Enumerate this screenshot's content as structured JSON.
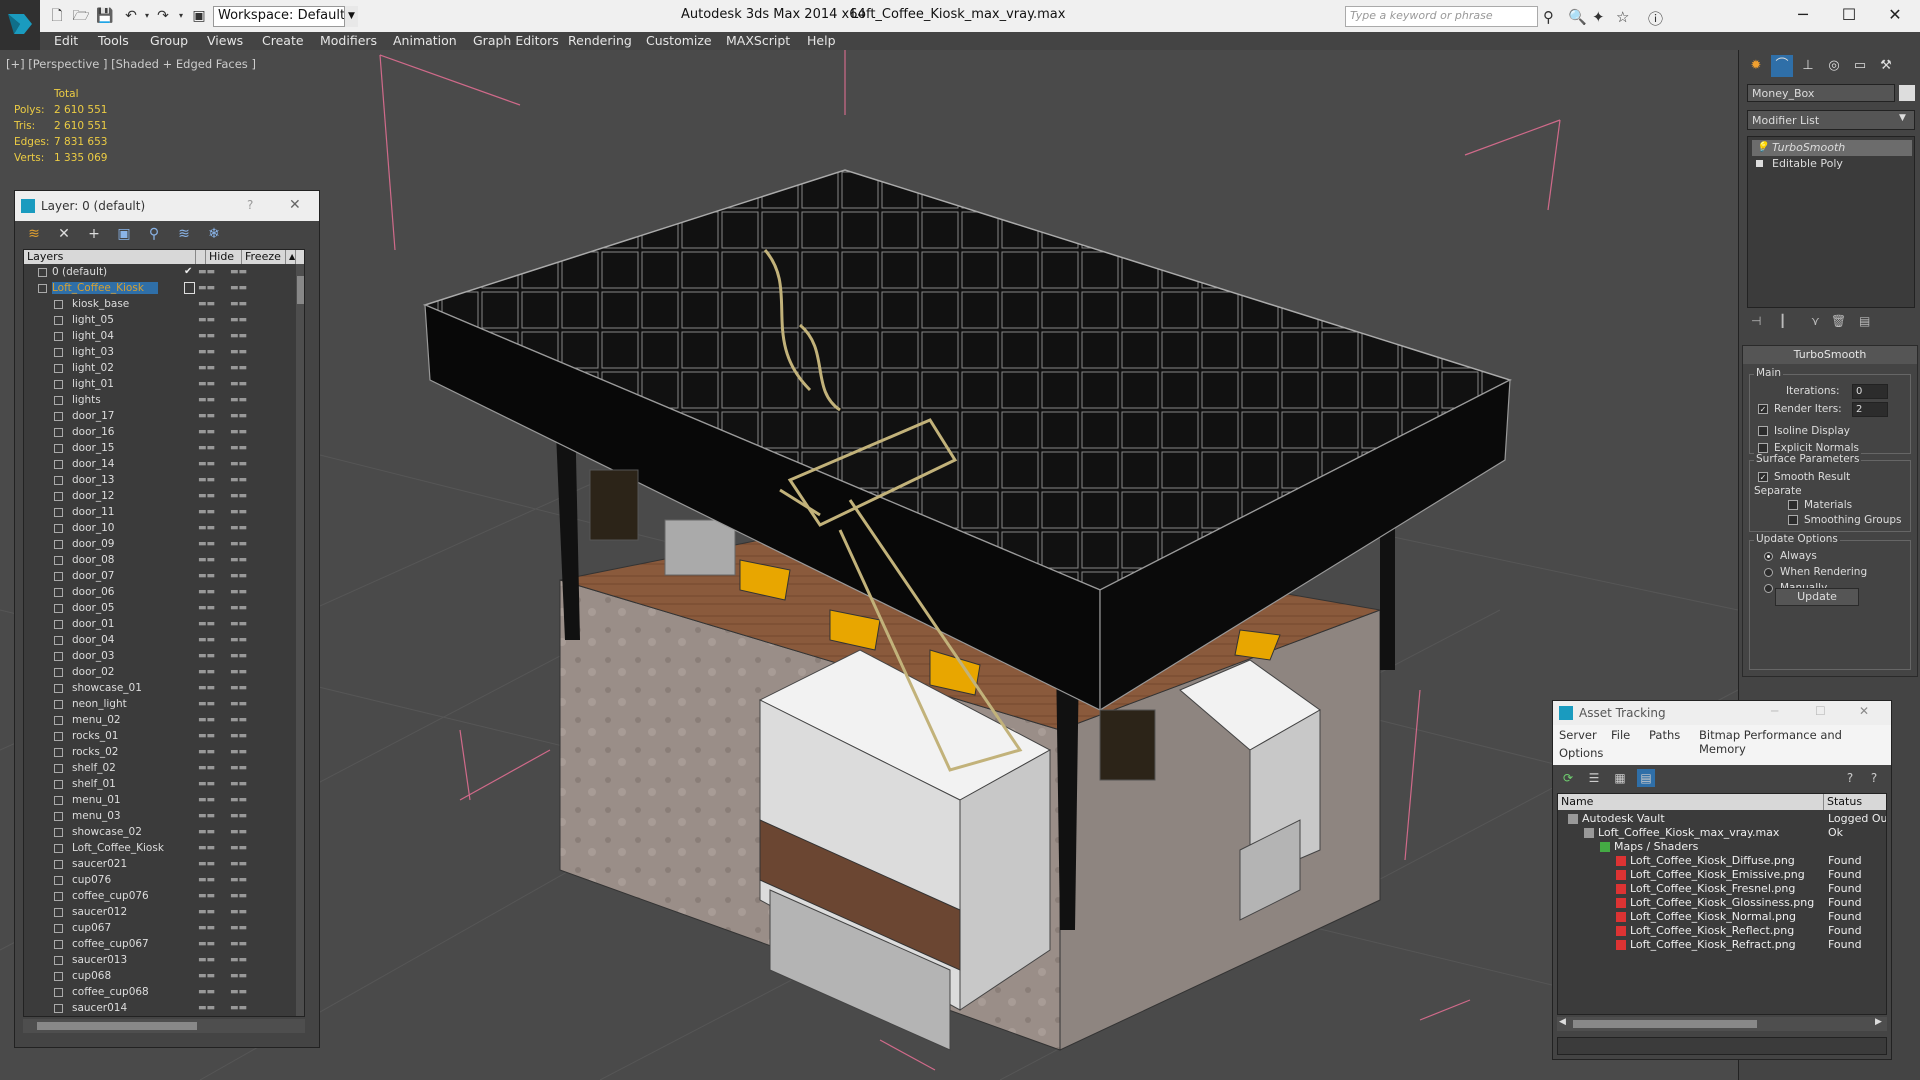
{
  "titlebar": {
    "workspace": "Workspace: Default",
    "app_title": "Autodesk 3ds Max  2014 x64",
    "file_title": "Loft_Coffee_Kiosk_max_vray.max",
    "search_placeholder": "Type a keyword or phrase"
  },
  "menu": [
    "Edit",
    "Tools",
    "Group",
    "Views",
    "Create",
    "Modifiers",
    "Animation",
    "Graph Editors",
    "Rendering",
    "Customize",
    "MAXScript",
    "Help"
  ],
  "viewport": {
    "label": "[+] [Perspective ] [Shaded + Edged Faces ]",
    "stats_header": "Total",
    "stats": [
      {
        "label": "Polys:",
        "value": "2 610 551"
      },
      {
        "label": "Tris:",
        "value": "2 610 551"
      },
      {
        "label": "Edges:",
        "value": "7 831 653"
      },
      {
        "label": "Verts:",
        "value": "1 335 069"
      }
    ]
  },
  "layer_panel": {
    "title": "Layer: 0 (default)",
    "help": "?",
    "col_layers": "Layers",
    "col_hide": "Hide",
    "col_freeze": "Freeze",
    "rows": [
      {
        "name": "0 (default)",
        "kind": "layer",
        "check": "✔"
      },
      {
        "name": "Loft_Coffee_Kiosk",
        "kind": "layer-selected",
        "check": ""
      },
      {
        "name": "kiosk_base"
      },
      {
        "name": "light_05"
      },
      {
        "name": "light_04"
      },
      {
        "name": "light_03"
      },
      {
        "name": "light_02"
      },
      {
        "name": "light_01"
      },
      {
        "name": "lights"
      },
      {
        "name": "door_17"
      },
      {
        "name": "door_16"
      },
      {
        "name": "door_15"
      },
      {
        "name": "door_14"
      },
      {
        "name": "door_13"
      },
      {
        "name": "door_12"
      },
      {
        "name": "door_11"
      },
      {
        "name": "door_10"
      },
      {
        "name": "door_09"
      },
      {
        "name": "door_08"
      },
      {
        "name": "door_07"
      },
      {
        "name": "door_06"
      },
      {
        "name": "door_05"
      },
      {
        "name": "door_01"
      },
      {
        "name": "door_04"
      },
      {
        "name": "door_03"
      },
      {
        "name": "door_02"
      },
      {
        "name": "showcase_01"
      },
      {
        "name": "neon_light"
      },
      {
        "name": "menu_02"
      },
      {
        "name": "rocks_01"
      },
      {
        "name": "rocks_02"
      },
      {
        "name": "shelf_02"
      },
      {
        "name": "shelf_01"
      },
      {
        "name": "menu_01"
      },
      {
        "name": "menu_03"
      },
      {
        "name": "showcase_02"
      },
      {
        "name": "Loft_Coffee_Kiosk"
      },
      {
        "name": "saucer021"
      },
      {
        "name": "cup076"
      },
      {
        "name": "coffee_cup076"
      },
      {
        "name": "saucer012"
      },
      {
        "name": "cup067"
      },
      {
        "name": "coffee_cup067"
      },
      {
        "name": "saucer013"
      },
      {
        "name": "cup068"
      },
      {
        "name": "coffee_cup068"
      },
      {
        "name": "saucer014"
      }
    ]
  },
  "command_panel": {
    "object_name": "Money_Box",
    "modifier_list": "Modifier List",
    "stack": [
      "TurboSmooth",
      "Editable Poly"
    ],
    "turbosmooth": {
      "title": "TurboSmooth",
      "main": "Main",
      "iterations_label": "Iterations:",
      "iterations": "0",
      "render_iters_label": "Render Iters:",
      "render_iters": "2",
      "isoline": "Isoline Display",
      "explicit_normals": "Explicit Normals",
      "surface_params": "Surface Parameters",
      "smooth_result": "Smooth Result",
      "separate": "Separate",
      "materials": "Materials",
      "smoothing_groups": "Smoothing Groups",
      "update_options": "Update Options",
      "always": "Always",
      "when_rendering": "When Rendering",
      "manually": "Manually",
      "update": "Update"
    }
  },
  "asset_panel": {
    "title": "Asset Tracking",
    "menu": [
      "Server",
      "File",
      "Paths",
      "Bitmap Performance and Memory",
      "Options"
    ],
    "col_name": "Name",
    "col_status": "Status",
    "rows": [
      {
        "name": "Autodesk Vault",
        "status": "Logged Ou",
        "indent": 0
      },
      {
        "name": "Loft_Coffee_Kiosk_max_vray.max",
        "status": "Ok",
        "indent": 1
      },
      {
        "name": "Maps / Shaders",
        "status": "",
        "indent": 2
      },
      {
        "name": "Loft_Coffee_Kiosk_Diffuse.png",
        "status": "Found",
        "indent": 3
      },
      {
        "name": "Loft_Coffee_Kiosk_Emissive.png",
        "status": "Found",
        "indent": 3
      },
      {
        "name": "Loft_Coffee_Kiosk_Fresnel.png",
        "status": "Found",
        "indent": 3
      },
      {
        "name": "Loft_Coffee_Kiosk_Glossiness.png",
        "status": "Found",
        "indent": 3
      },
      {
        "name": "Loft_Coffee_Kiosk_Normal.png",
        "status": "Found",
        "indent": 3
      },
      {
        "name": "Loft_Coffee_Kiosk_Reflect.png",
        "status": "Found",
        "indent": 3
      },
      {
        "name": "Loft_Coffee_Kiosk_Refract.png",
        "status": "Found",
        "indent": 3
      }
    ]
  }
}
